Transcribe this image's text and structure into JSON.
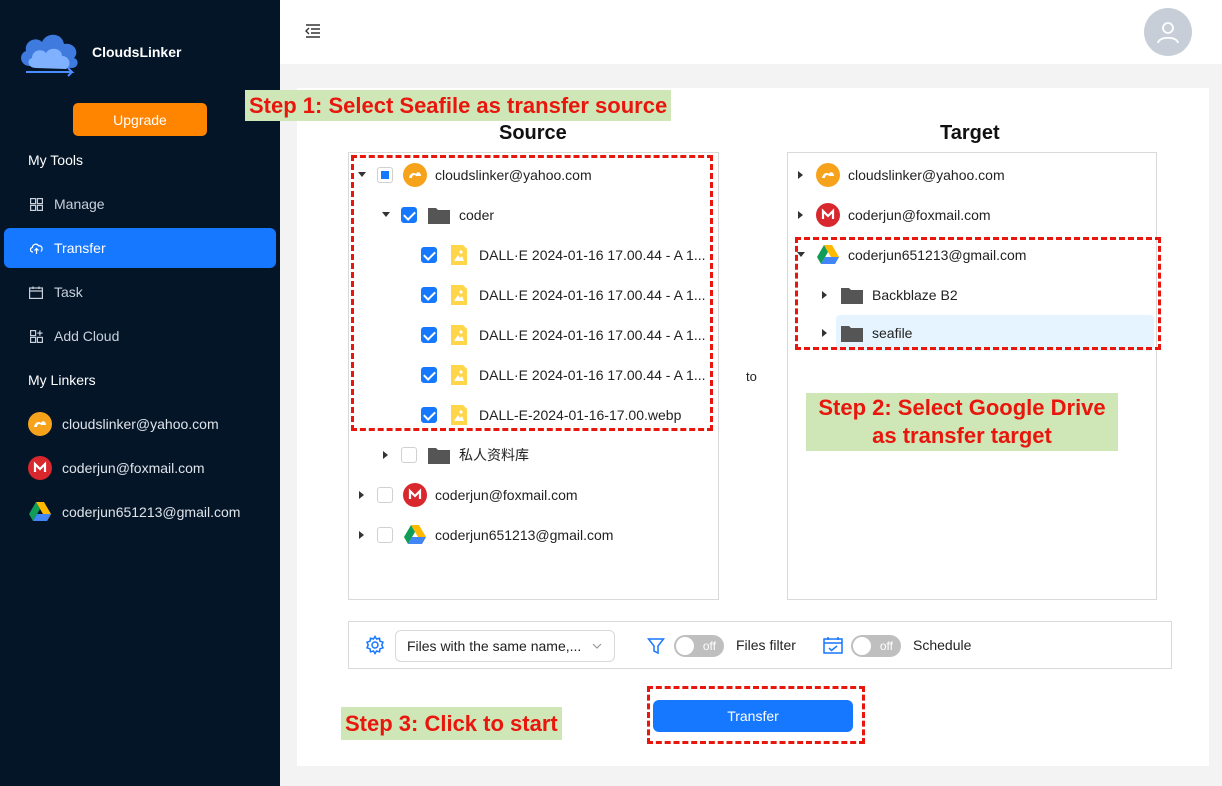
{
  "app": {
    "name": "CloudsLinker"
  },
  "sidebar": {
    "upgrade_label": "Upgrade",
    "tools_title": "My Tools",
    "nav": [
      {
        "label": "Manage",
        "icon": "grid-icon"
      },
      {
        "label": "Transfer",
        "icon": "cloud-upload-icon",
        "active": true
      },
      {
        "label": "Task",
        "icon": "calendar-icon"
      },
      {
        "label": "Add Cloud",
        "icon": "add-grid-icon"
      }
    ],
    "linkers_title": "My Linkers",
    "linkers": [
      {
        "label": "cloudslinker@yahoo.com",
        "icon": "seafile-icon"
      },
      {
        "label": "coderjun@foxmail.com",
        "icon": "mega-icon"
      },
      {
        "label": "coderjun651213@gmail.com",
        "icon": "google-drive-icon"
      }
    ]
  },
  "source": {
    "title": "Source",
    "rows": [
      {
        "label": "cloudslinker@yahoo.com",
        "icon": "seafile-icon",
        "state": "partial",
        "expanded": true
      },
      {
        "label": "coder",
        "icon": "folder-icon",
        "state": "checked",
        "expanded": true
      },
      {
        "label": "DALL·E 2024-01-16 17.00.44 - A 1...",
        "icon": "image-file-icon",
        "state": "checked"
      },
      {
        "label": "DALL·E 2024-01-16 17.00.44 - A 1...",
        "icon": "image-file-icon",
        "state": "checked"
      },
      {
        "label": "DALL·E 2024-01-16 17.00.44 - A 1...",
        "icon": "image-file-icon",
        "state": "checked"
      },
      {
        "label": "DALL·E 2024-01-16 17.00.44 - A 1...",
        "icon": "image-file-icon",
        "state": "checked"
      },
      {
        "label": "DALL-E-2024-01-16-17.00.webp",
        "icon": "image-file-icon",
        "state": "checked"
      },
      {
        "label": "私人资料库",
        "icon": "folder-icon",
        "state": "unchecked",
        "expanded": false
      },
      {
        "label": "coderjun@foxmail.com",
        "icon": "mega-icon",
        "state": "unchecked",
        "expanded": false
      },
      {
        "label": "coderjun651213@gmail.com",
        "icon": "google-drive-icon",
        "state": "unchecked",
        "expanded": false
      }
    ]
  },
  "to_label": "to",
  "target": {
    "title": "Target",
    "rows": [
      {
        "label": "cloudslinker@yahoo.com",
        "icon": "seafile-icon",
        "expanded": false
      },
      {
        "label": "coderjun@foxmail.com",
        "icon": "mega-icon",
        "expanded": false
      },
      {
        "label": "coderjun651213@gmail.com",
        "icon": "google-drive-icon",
        "expanded": true
      },
      {
        "label": "Backblaze B2",
        "icon": "folder-icon",
        "expanded": false
      },
      {
        "label": "seafile",
        "icon": "folder-icon",
        "expanded": false,
        "selected": true
      }
    ]
  },
  "options": {
    "conflict_select": "Files with the same name,...",
    "filter_switch": "off",
    "filter_label": "Files filter",
    "schedule_switch": "off",
    "schedule_label": "Schedule"
  },
  "transfer_label": "Transfer",
  "annotations": {
    "step1": "Step 1: Select Seafile as transfer source",
    "step2_line1": "Step 2: Select Google Drive",
    "step2_line2": "as transfer target",
    "step3": "Step 3: Click to start"
  },
  "colors": {
    "accent": "#1677ff",
    "sidebar": "#041528",
    "upgrade": "#ff8400",
    "annotation": "#e8160c",
    "annotation_bg": "#cfe6b7"
  }
}
